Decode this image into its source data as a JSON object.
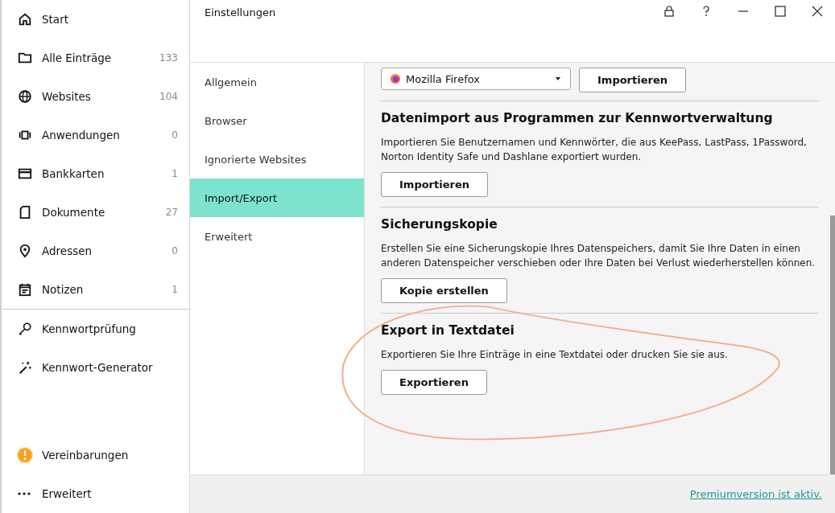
{
  "sidebar": {
    "items": [
      {
        "label": "Start",
        "selected": false
      },
      {
        "label": "Alle Einträge",
        "count": "133",
        "selected": false
      },
      {
        "label": "Websites",
        "count": "104",
        "selected": false
      },
      {
        "label": "Anwendungen",
        "count": "0",
        "selected": false
      },
      {
        "label": "Bankkarten",
        "count": "1",
        "selected": false
      },
      {
        "label": "Dokumente",
        "count": "27",
        "selected": false
      },
      {
        "label": "Adressen",
        "count": "0",
        "selected": false
      },
      {
        "label": "Notizen",
        "count": "1",
        "selected": false
      }
    ],
    "tools": [
      {
        "label": "Kennwortprüfung"
      },
      {
        "label": "Kennwort-Generator"
      }
    ],
    "bottom": [
      {
        "label": "Vereinbarungen"
      },
      {
        "label": "Erweitert"
      }
    ]
  },
  "window": {
    "title": "Einstellungen"
  },
  "settings_nav": [
    {
      "label": "Allgemein",
      "selected": false
    },
    {
      "label": "Browser",
      "selected": false
    },
    {
      "label": "Ignorierte Websites",
      "selected": false
    },
    {
      "label": "Import/Export",
      "selected": true
    },
    {
      "label": "Erweitert",
      "selected": false
    }
  ],
  "browser_import": {
    "dropdown": "Mozilla Firefox",
    "button": "Importieren"
  },
  "sections": [
    {
      "title": "Datenimport aus Programmen zur Kennwortverwaltung",
      "text": "Importieren Sie Benutzernamen und Kennwörter, die aus KeePass, LastPass, 1Password, Norton Identity Safe und Dashlane exportiert wurden.",
      "button": "Importieren"
    },
    {
      "title": "Sicherungskopie",
      "text": "Erstellen Sie eine Sicherungskopie Ihres Datenspeichers, damit Sie Ihre Daten in einen anderen Datenspeicher verschieben oder Ihre Daten bei Verlust wiederherstellen können.",
      "button": "Kopie erstellen"
    },
    {
      "title": "Export in Textdatei",
      "text": "Exportieren Sie Ihre Einträge in eine Textdatei oder drucken Sie sie aus.",
      "button": "Exportieren"
    }
  ],
  "footer": {
    "link": "Premiumversion ist aktiv."
  }
}
